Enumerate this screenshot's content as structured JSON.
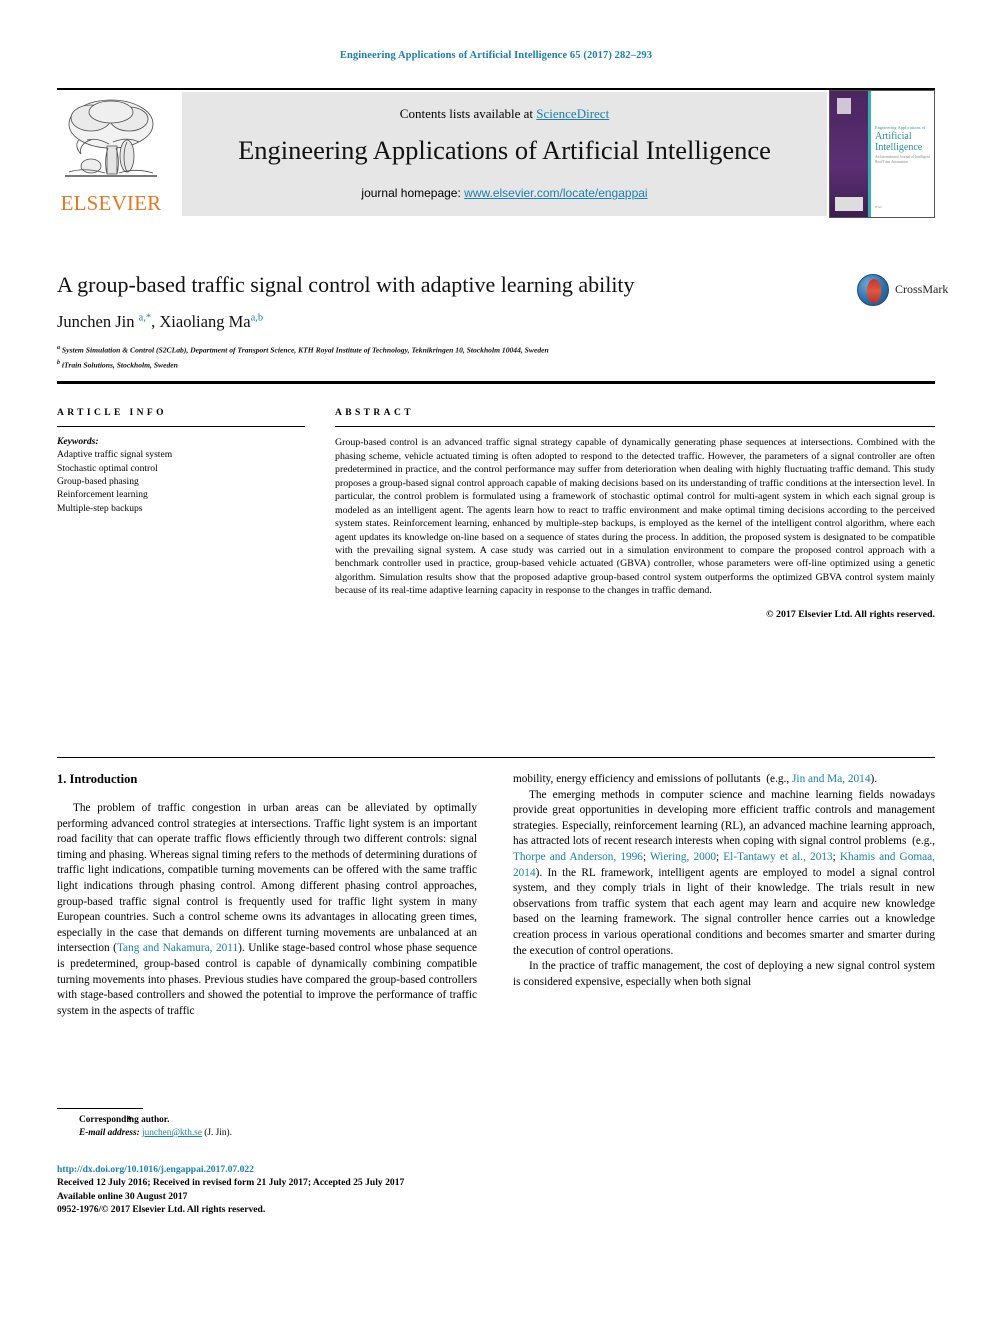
{
  "running_head": "Engineering Applications of Artificial Intelligence 65 (2017) 282–293",
  "masthead": {
    "contents_prefix": "Contents lists available at ",
    "contents_link": "ScienceDirect",
    "journal_title": "Engineering Applications of Artificial Intelligence",
    "homepage_prefix": "journal homepage: ",
    "homepage_link": "www.elsevier.com/locate/engappai",
    "publisher_name": "ELSEVIER",
    "cover": {
      "line_small": "Engineering Applications of",
      "line_big": "Artificial\nIntelligence",
      "line_sub": "An International Journal of Intelligent Real-Time Automation",
      "badge": "IFAC"
    }
  },
  "article": {
    "title": "A group-based traffic signal control with adaptive learning ability",
    "authors_html": "Junchen Jin <sup>a,*</sup>, Xiaoliang Ma<sup>a,b</sup>",
    "affiliation_a": "System Simulation & Control (S2CLab), Department of Transport Science, KTH Royal Institute of Technology, Teknikringen 10, Stockholm 10044, Sweden",
    "affiliation_b": "iTrain Solutions, Stockholm, Sweden",
    "crossmark_label": "CrossMark"
  },
  "info": {
    "label": "ARTICLE INFO",
    "keywords_heading": "Keywords:",
    "keywords": [
      "Adaptive traffic signal system",
      "Stochastic optimal control",
      "Group-based phasing",
      "Reinforcement learning",
      "Multiple-step backups"
    ]
  },
  "abstract": {
    "label": "ABSTRACT",
    "text": "Group-based control is an advanced traffic signal strategy capable of dynamically generating phase sequences at intersections. Combined with the phasing scheme, vehicle actuated timing is often adopted to respond to the detected traffic. However, the parameters of a signal controller are often predetermined in practice, and the control performance may suffer from deterioration when dealing with highly fluctuating traffic demand. This study proposes a group-based signal control approach capable of making decisions based on its understanding of traffic conditions at the intersection level. In particular, the control problem is formulated using a framework of stochastic optimal control for multi-agent system in which each signal group is modeled as an intelligent agent. The agents learn how to react to traffic environment and make optimal timing decisions according to the perceived system states. Reinforcement learning, enhanced by multiple-step backups, is employed as the kernel of the intelligent control algorithm, where each agent updates its knowledge on-line based on a sequence of states during the process. In addition, the proposed system is designated to be compatible with the prevailing signal system. A case study was carried out in a simulation environment to compare the proposed control approach with a benchmark controller used in practice, group-based vehicle actuated (GBVA) controller, whose parameters were off-line optimized using a genetic algorithm. Simulation results show that the proposed adaptive group-based control system outperforms the optimized GBVA control system mainly because of its real-time adaptive learning capacity in response to the changes in traffic demand.",
    "copyright": "© 2017 Elsevier Ltd. All rights reserved."
  },
  "body": {
    "section_title": "1. Introduction",
    "left_p1_html": "The problem of traffic congestion in urban areas can be alleviated by optimally performing advanced control strategies at intersections. Traffic light system is an important road facility that can operate traffic flows efficiently through two different controls: signal timing and phasing. Whereas signal timing refers to the methods of determining durations of traffic light indications, compatible turning movements can be offered with the same traffic light indications through phasing control. Among different phasing control approaches, group-based traffic signal control is frequently used for traffic light system in many European countries. Such a control scheme owns its advantages in allocating green times, especially in the case that demands on different turning movements are unbalanced at an intersection (<span class=\"ref\">Tang and Nakamura, 2011</span>). Unlike stage-based control whose phase sequence is predetermined, group-based control is capable of dynamically combining compatible turning movements into phases. Previous studies have compared the group-based controllers with stage-based controllers and showed the potential to improve the performance of traffic system in the aspects of traffic",
    "right_p1_html": "mobility, energy efficiency and emissions of pollutants&nbsp; (e.g., <span class=\"ref\">Jin and Ma, 2014</span>).",
    "right_p2_html": "The emerging methods in computer science and machine learning fields nowadays provide great opportunities in developing more efficient traffic controls and management strategies. Especially, reinforcement learning (RL), an advanced machine learning approach, has attracted lots of recent research interests when coping with signal control problems&nbsp; (e.g., <span class=\"ref\">Thorpe and Anderson, 1996</span>; <span class=\"ref\">Wiering, 2000</span>; <span class=\"ref\">El-Tantawy et al., 2013</span>; <span class=\"ref\">Khamis and Gomaa, 2014</span>). In the RL framework, intelligent agents are employed to model a signal control system, and they comply trials in light of their knowledge. The trials result in new observations from traffic system that each agent may learn and acquire new knowledge based on the learning framework. The signal controller hence carries out a knowledge creation process in various operational conditions and becomes smarter and smarter during the execution of control operations.",
    "right_p3_html": "In the practice of traffic management, the cost of deploying a new signal control system is considered expensive, especially when both signal"
  },
  "footer": {
    "corresponding_star": "*",
    "corresponding_text": "Corresponding author.",
    "email_label": "E-mail address:",
    "email": "junchen@kth.se",
    "email_suffix": " (J. Jin).",
    "doi": "http://dx.doi.org/10.1016/j.engappai.2017.07.022",
    "received": "Received 12 July 2016; Received in revised form 21 July 2017; Accepted 25 July 2017",
    "available": "Available online 30 August 2017",
    "issn_line": "0952-1976/© 2017 Elsevier Ltd. All rights reserved."
  },
  "colors": {
    "link_blue": "#1a7fae",
    "elsevier_orange": "#E87722"
  }
}
